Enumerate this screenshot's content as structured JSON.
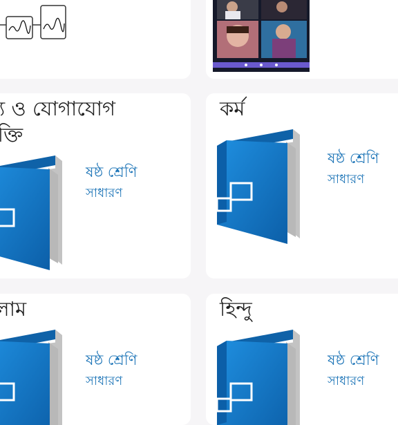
{
  "colors": {
    "background": "#f6f5f7",
    "card": "#ffffff",
    "accent_text": "#1c74b7",
    "book_blue": "#1a7ed0",
    "book_blue_dark": "#0f62a8",
    "page_gray": "#c3c3c3"
  },
  "top_row": {
    "left_card": {
      "signature_icons": [
        "signature-stamp-icon",
        "signature-stamp-icon"
      ]
    },
    "right_card": {
      "thumbnail_icon": "video-call-screenshot-icon"
    }
  },
  "cards": [
    {
      "title_line1": "থ্য ও যোগাযোগ",
      "title_line2": "যুক্তি",
      "grade": "ষষ্ঠ শ্রেণি",
      "stream": "সাধারণ"
    },
    {
      "title_line1": "কর্ম",
      "title_line2": "",
      "grade": "ষষ্ঠ শ্রেণি",
      "stream": "সাধারণ"
    },
    {
      "title_line1": "লাম",
      "title_line2": "",
      "grade": "ষষ্ঠ শ্রেণি",
      "stream": "সাধারণ"
    },
    {
      "title_line1": "হিন্দু",
      "title_line2": "",
      "grade": "ষষ্ঠ শ্রেণি",
      "stream": "সাধারণ"
    }
  ]
}
